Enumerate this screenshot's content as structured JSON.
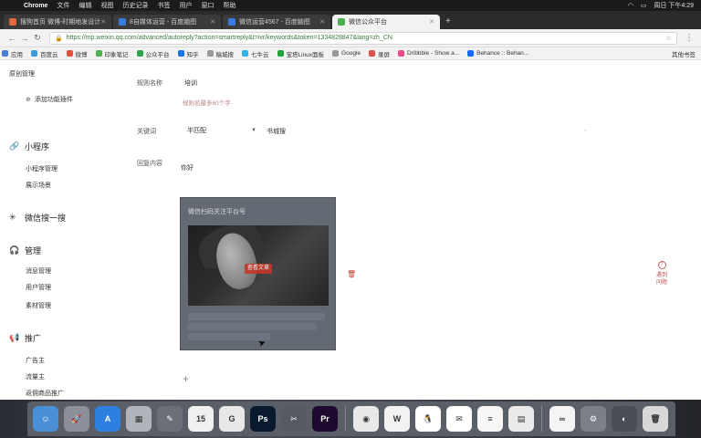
{
  "menubar": {
    "app_name": "Chrome",
    "menus": [
      "文件",
      "编辑",
      "视图",
      "历史记录",
      "书签",
      "用户",
      "窗口",
      "帮助"
    ],
    "clock": "周日 下午4:29"
  },
  "tabs": [
    {
      "label": "搜狗首页 微博-时期地发设计",
      "active": false
    },
    {
      "label": "8自媒体运营 - 百度脑图",
      "active": false
    },
    {
      "label": "微信运营4567 - 百度脑图",
      "active": false
    },
    {
      "label": "微信公众平台",
      "active": true
    }
  ],
  "address": {
    "url": "https://mp.weixin.qq.com/advanced/autoreply?action=smartreply&t=ivr/keywords&token=1334828847&lang=zh_CN"
  },
  "bookmarks": [
    {
      "label": "应用",
      "color": "#4a7bd6"
    },
    {
      "label": "百度云",
      "color": "#3a9be0"
    },
    {
      "label": "微博",
      "color": "#e0503a"
    },
    {
      "label": "印象笔记",
      "color": "#4caf50"
    },
    {
      "label": "公众平台",
      "color": "#2da44e"
    },
    {
      "label": "知乎",
      "color": "#1a73e8"
    },
    {
      "label": "稿城搜",
      "color": "#999999"
    },
    {
      "label": "七牛云",
      "color": "#2bb3e6"
    },
    {
      "label": "宝塔Linux面板",
      "color": "#20a53a"
    },
    {
      "label": "Google",
      "color": "#999999"
    },
    {
      "label": "录屏",
      "color": "#d9534f"
    },
    {
      "label": "Dribbble - Show a...",
      "color": "#ea4c89"
    },
    {
      "label": "Behance :: Behan...",
      "color": "#1769ff"
    }
  ],
  "bookmarks_other": "其他书签",
  "sidebar": {
    "top_link": "原创管理",
    "add_plugin": "添加功能插件",
    "sections": [
      {
        "title": "小程序",
        "icon": "link-icon",
        "items": [
          "小程序管理",
          "展示场景"
        ]
      },
      {
        "title": "微信搜一搜",
        "icon": "sparkle-icon",
        "items": []
      },
      {
        "title": "管理",
        "icon": "headset-icon",
        "items": [
          "消息管理",
          "用户管理",
          "素材管理"
        ]
      },
      {
        "title": "推广",
        "icon": "megaphone-icon",
        "items": [
          "广告主",
          "流量主",
          "返佣商品推广"
        ]
      }
    ]
  },
  "form": {
    "rule_name_label": "规则名称",
    "rule_name_value": "培训",
    "rule_name_hint": "规则名最多60个字",
    "keyword_label": "关键词",
    "match_mode": "半匹配",
    "keyword_value": "书城搜",
    "reply_label": "回复内容",
    "reply_value": "你好",
    "card_title": "微信扫码关注平台号",
    "card_button": "查看文章",
    "add_symbol": "+"
  },
  "feedback": {
    "label": "遇到问题"
  },
  "dock_apps": [
    {
      "name": "finder-icon",
      "color": "#4a90d9",
      "glyph": "☺"
    },
    {
      "name": "launchpad-icon",
      "color": "#8a8f99",
      "glyph": "🚀"
    },
    {
      "name": "app-store-icon",
      "color": "#2d7fe0",
      "glyph": "A"
    },
    {
      "name": "photos-icon",
      "color": "#b0b4bb",
      "glyph": "▦"
    },
    {
      "name": "tools-icon",
      "color": "#6c6f76",
      "glyph": "✎"
    },
    {
      "name": "calendar-icon",
      "color": "#f0f0f0",
      "glyph": "15"
    },
    {
      "name": "swirl-icon",
      "color": "#e8e8e8",
      "glyph": "G"
    },
    {
      "name": "photoshop-icon",
      "color": "#0a1a2e",
      "glyph": "Ps"
    },
    {
      "name": "video-icon",
      "color": "#555a62",
      "glyph": "✂"
    },
    {
      "name": "premiere-icon",
      "color": "#1e0a2e",
      "glyph": "Pr"
    },
    {
      "name": "sep",
      "color": "",
      "glyph": ""
    },
    {
      "name": "chrome-icon",
      "color": "#e9e9e9",
      "glyph": "◉"
    },
    {
      "name": "wps-icon",
      "color": "#f2f2f2",
      "glyph": "W"
    },
    {
      "name": "qq-icon",
      "color": "#ffffff",
      "glyph": "🐧"
    },
    {
      "name": "wechat-icon",
      "color": "#ffffff",
      "glyph": "✉"
    },
    {
      "name": "notes-icon",
      "color": "#f7f7f7",
      "glyph": "≡"
    },
    {
      "name": "files-icon",
      "color": "#eaeaea",
      "glyph": "▤"
    },
    {
      "name": "sep",
      "color": "",
      "glyph": ""
    },
    {
      "name": "baidu-netdisk-icon",
      "color": "#f5f5f5",
      "glyph": "∞"
    },
    {
      "name": "system-prefs-icon",
      "color": "#7a7f88",
      "glyph": "⚙"
    },
    {
      "name": "downloads-icon",
      "color": "#4a4e56",
      "glyph": "◐"
    },
    {
      "name": "trash-icon",
      "color": "#d8d8d8",
      "glyph": "🗑"
    }
  ]
}
